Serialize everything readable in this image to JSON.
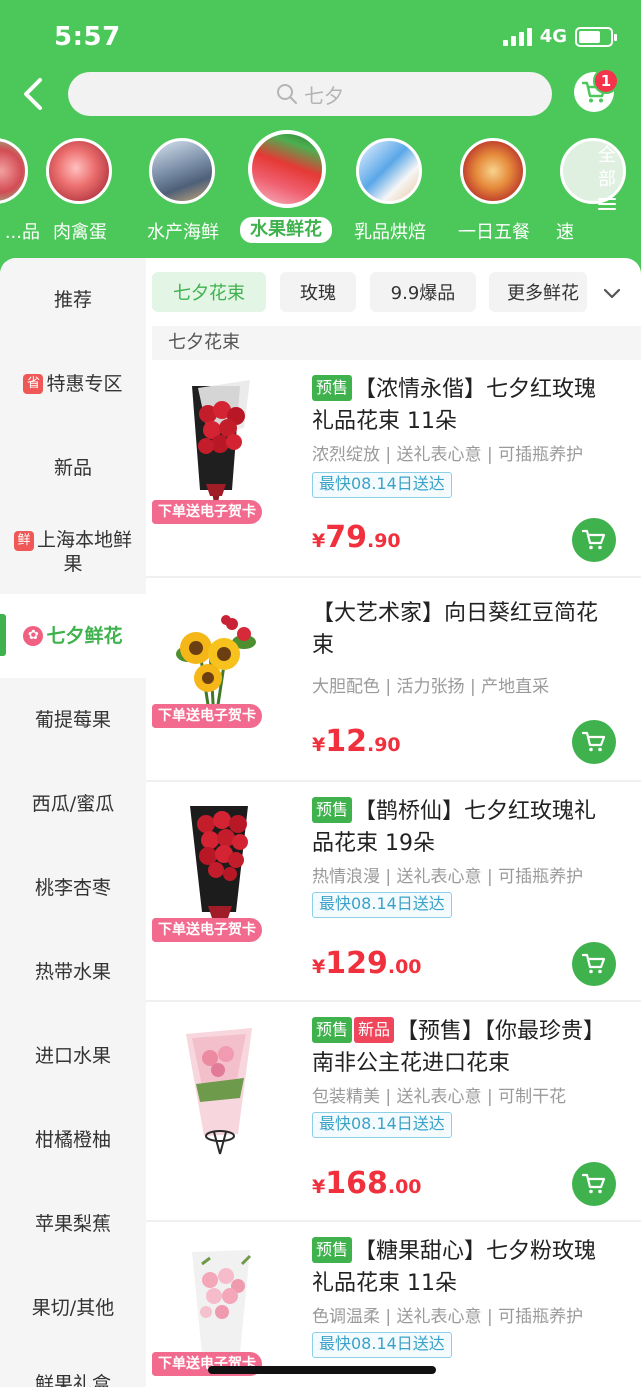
{
  "status": {
    "time": "5:57",
    "network": "4G"
  },
  "search": {
    "placeholder": "七夕"
  },
  "cart": {
    "badge": "1"
  },
  "categories": [
    {
      "label": "...品"
    },
    {
      "label": "肉禽蛋"
    },
    {
      "label": "水产海鲜"
    },
    {
      "label": "水果鲜花",
      "active": true
    },
    {
      "label": "乳品烘焙"
    },
    {
      "label": "一日五餐"
    },
    {
      "label": "速"
    }
  ],
  "all_categories_label": "全部",
  "sidebar": [
    {
      "label": "推荐"
    },
    {
      "label": "特惠专区",
      "tag": "省"
    },
    {
      "label": "新品"
    },
    {
      "label": "上海本地鲜果",
      "tag": "鲜"
    },
    {
      "label": "七夕鲜花",
      "active": true
    },
    {
      "label": "葡提莓果"
    },
    {
      "label": "西瓜/蜜瓜"
    },
    {
      "label": "桃李杏枣"
    },
    {
      "label": "热带水果"
    },
    {
      "label": "进口水果"
    },
    {
      "label": "柑橘橙柚"
    },
    {
      "label": "苹果梨蕉"
    },
    {
      "label": "果切/其他"
    },
    {
      "label": "鲜果礼盒"
    }
  ],
  "filters": [
    {
      "label": "七夕花束",
      "active": true
    },
    {
      "label": "玫瑰"
    },
    {
      "label": "9.9爆品"
    },
    {
      "label": "更多鲜花"
    }
  ],
  "section_title": "七夕花束",
  "card_ribbon": "下单送电子贺卡",
  "tags": {
    "presale": "预售",
    "new": "新品"
  },
  "products": [
    {
      "title": "【浓情永偕】七夕红玫瑰礼品花束 11朵",
      "presale": true,
      "features": "浓烈绽放 | 送礼表心意 | 可插瓶养护",
      "delivery": "最快08.14日送达",
      "price_int": "79",
      "price_dec": ".90"
    },
    {
      "title": "【大艺术家】向日葵红豆简花束",
      "features": "大胆配色 | 活力张扬 | 产地直采",
      "price_int": "12",
      "price_dec": ".90"
    },
    {
      "title": "【鹊桥仙】七夕红玫瑰礼品花束 19朵",
      "presale": true,
      "features": "热情浪漫 | 送礼表心意 | 可插瓶养护",
      "delivery": "最快08.14日送达",
      "price_int": "129",
      "price_dec": ".00"
    },
    {
      "title": "【预售】【你最珍贵】南非公主花进口花束",
      "presale": true,
      "is_new": true,
      "features": "包装精美 | 送礼表心意 | 可制干花",
      "delivery": "最快08.14日送达",
      "price_int": "168",
      "price_dec": ".00"
    },
    {
      "title": "【糖果甜心】七夕粉玫瑰礼品花束 11朵",
      "presale": true,
      "features": "色调温柔 | 送礼表心意 | 可插瓶养护",
      "delivery": "最快08.14日送达"
    }
  ],
  "currency": "¥",
  "colors": {
    "brand_green": "#4cc75a",
    "price_red": "#f0303c",
    "badge_red": "#f3344a",
    "ribbon_pink": "#f26b8f"
  }
}
